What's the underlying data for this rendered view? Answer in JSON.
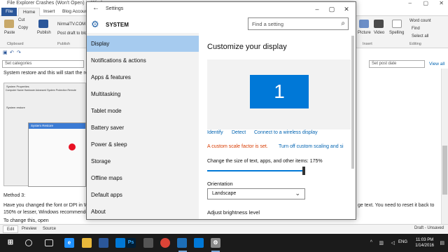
{
  "background_app": {
    "title": "File Explorer Crashes (Won't Open) in Windo",
    "ribbon_tabs": [
      "File",
      "Home",
      "Insert",
      "Blog Account"
    ],
    "ribbon_items": {
      "paste": "Paste",
      "cut": "Cut",
      "copy": "Copy",
      "publish": "Publish",
      "nirmaltv": "NirmalTV.COM",
      "post_draft": "Post draft to blo",
      "picture": "Picture",
      "video": "Video",
      "spelling": "Spelling",
      "word_count": "Word count",
      "find": "Find",
      "select_all": "Select all"
    },
    "groups": [
      "Clipboard",
      "Publish",
      "Insert",
      "Editing"
    ],
    "category_placeholder": "Set categories",
    "post_date_placeholder": "Set post date",
    "view_all": "View all",
    "body_lines": {
      "l1": "System restore and this will start the re",
      "l2": "Method 3:",
      "l3": "Have you changed the font or DPI in W",
      "l3b": "ge text. You need to reset it back to",
      "l4": "150% or lesser, Windows recommende",
      "l5": "To change this, open"
    },
    "screenshot_texts": {
      "title": "System Properties",
      "tabs": "Computer Name  Hardware  Advanced  System Protection  Remote",
      "restore": "System restore",
      "dialog_title": "System Restore"
    },
    "view_tabs": [
      "Edit",
      "Preview",
      "Source"
    ],
    "status": "Draft - Unsaved"
  },
  "settings": {
    "window_title": "Settings",
    "header": "SYSTEM",
    "search_placeholder": "Find a setting",
    "nav_items": [
      "Display",
      "Notifications & actions",
      "Apps & features",
      "Multitasking",
      "Tablet mode",
      "Battery saver",
      "Power & sleep",
      "Storage",
      "Offline maps",
      "Default apps",
      "About"
    ],
    "active_nav_index": 0,
    "main": {
      "title": "Customize your display",
      "monitor_number": "1",
      "links": [
        "Identify",
        "Detect",
        "Connect to a wireless display"
      ],
      "warning": "A custom scale factor is set.",
      "turn_off_link": "Turn off custom scaling and si",
      "scale_label": "Change the size of text, apps, and other items: 175%",
      "scale_value_percent": 175,
      "orientation_label": "Orientation",
      "orientation_value": "Landscape",
      "brightness_label": "Adjust brightness level"
    }
  },
  "taskbar": {
    "language": "ENG",
    "time": "11:03 PM",
    "date": "1/14/2016"
  },
  "colors": {
    "accent": "#0078d7",
    "nav_active": "#a6cbef",
    "warning": "#d83b01",
    "link": "#0063b1",
    "taskbar": "#1b1b1b"
  }
}
